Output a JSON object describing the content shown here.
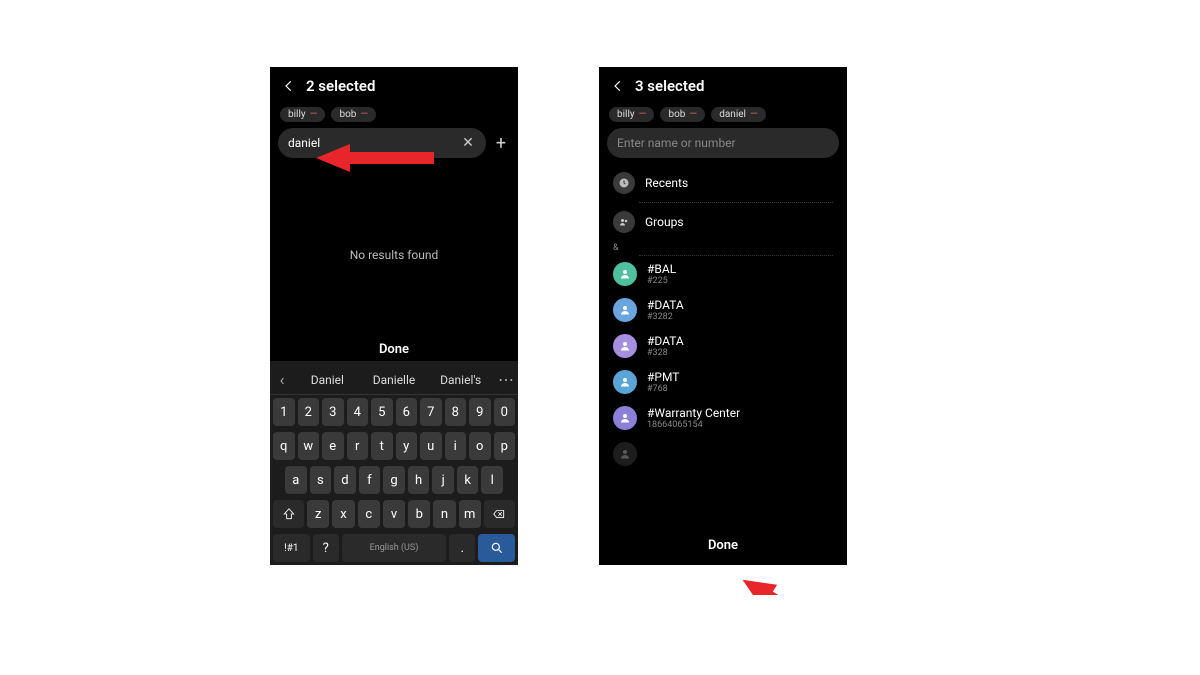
{
  "left": {
    "header": {
      "title": "2 selected"
    },
    "chips": [
      {
        "name": "billy"
      },
      {
        "name": "bob"
      }
    ],
    "search": {
      "value": "daniel",
      "placeholder": "Enter name or number"
    },
    "no_results": "No results found",
    "done_label": "Done",
    "suggestions": [
      "Daniel",
      "Danielle",
      "Daniel's"
    ],
    "keyboard": {
      "row1": [
        "1",
        "2",
        "3",
        "4",
        "5",
        "6",
        "7",
        "8",
        "9",
        "0"
      ],
      "row2": [
        "q",
        "w",
        "e",
        "r",
        "t",
        "y",
        "u",
        "i",
        "o",
        "p"
      ],
      "row3": [
        "a",
        "s",
        "d",
        "f",
        "g",
        "h",
        "j",
        "k",
        "l"
      ],
      "row4": [
        "z",
        "x",
        "c",
        "v",
        "b",
        "n",
        "m"
      ],
      "symkey": "!#1",
      "qkey": "?",
      "spacekey": "English (US)",
      "dotkey": "."
    }
  },
  "right": {
    "header": {
      "title": "3 selected"
    },
    "chips": [
      {
        "name": "billy"
      },
      {
        "name": "bob"
      },
      {
        "name": "daniel"
      }
    ],
    "search": {
      "value": "",
      "placeholder": "Enter name or number"
    },
    "sections": {
      "recents": "Recents",
      "groups": "Groups",
      "letter": "&"
    },
    "contacts": [
      {
        "name": "#BAL",
        "sub": "#225",
        "color": "#4fbfa0"
      },
      {
        "name": "#DATA",
        "sub": "#3282",
        "color": "#6aa5e0"
      },
      {
        "name": "#DATA",
        "sub": "#328",
        "color": "#a590e0"
      },
      {
        "name": "#PMT",
        "sub": "#768",
        "color": "#5aa5d8"
      },
      {
        "name": "#Warranty Center",
        "sub": "18664065154",
        "color": "#8b7fd8"
      }
    ],
    "done_label": "Done"
  }
}
